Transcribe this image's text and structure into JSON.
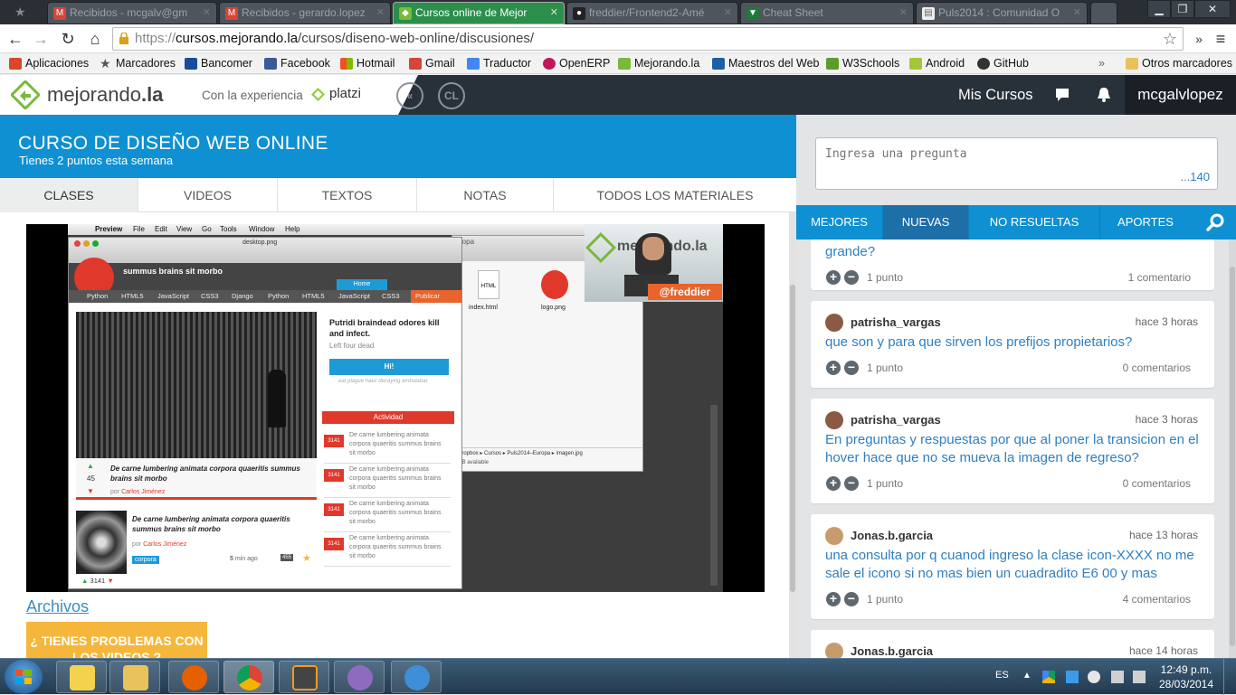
{
  "browser": {
    "tabs": [
      {
        "label": "Recibidos - mcgalv@gm",
        "color": "#d44638",
        "active": false
      },
      {
        "label": "Recibidos - gerardo.lopez",
        "color": "#d44638",
        "active": false
      },
      {
        "label": "Cursos online de Mejor",
        "color": "#7ab93b",
        "active": true
      },
      {
        "label": "freddier/Frontend2-Amé",
        "color": "#333333",
        "active": false
      },
      {
        "label": "Cheat Sheet",
        "color": "#1d7a3a",
        "active": false
      },
      {
        "label": "Puls2014 : Comunidad O",
        "color": "#ffffff",
        "active": false
      }
    ],
    "address": {
      "protocol": "https://",
      "host": "cursos.mejorando.la",
      "path": "/cursos/diseno-web-online/discusiones/"
    },
    "bookmarks": [
      {
        "label": "Aplicaciones",
        "color": "#d9472b"
      },
      {
        "label": "Marcadores",
        "color": "#555555"
      },
      {
        "label": "Bancomer",
        "color": "#1a4c9a"
      },
      {
        "label": "Facebook",
        "color": "#3b5998"
      },
      {
        "label": "Hotmail",
        "color": "#f25022"
      },
      {
        "label": "Gmail",
        "color": "#d44638"
      },
      {
        "label": "Traductor",
        "color": "#4285f4"
      },
      {
        "label": "OpenERP",
        "color": "#c2185b"
      },
      {
        "label": "Mejorando.la",
        "color": "#7ab93b"
      },
      {
        "label": "Maestros del Web",
        "color": "#1c5fa3"
      },
      {
        "label": "W3Schools",
        "color": "#5c9c2d"
      },
      {
        "label": "Android",
        "color": "#a4c639"
      },
      {
        "label": "GitHub",
        "color": "#333333"
      }
    ],
    "other_bookmarks": "Otros marcadores",
    "overflow_label": "»"
  },
  "site": {
    "logo_main": "mejorando",
    "logo_suffix": ".la",
    "experience_text": "Con la experiencia",
    "platzi": "platzi",
    "circle1": "«",
    "circle2": "CL",
    "mis_cursos": "Mis Cursos",
    "username": "mcgalvlopez"
  },
  "course": {
    "title": "CURSO DE DISEÑO WEB ONLINE",
    "points": "Tienes 2 puntos esta semana",
    "tabs": [
      "CLASES",
      "VIDEOS",
      "TEXTOS",
      "NOTAS",
      "TODOS LOS MATERIALES"
    ],
    "active_tab": "CLASES"
  },
  "video": {
    "app_menu": [
      "Preview",
      "File",
      "Edit",
      "View",
      "Go",
      "Tools",
      "Window",
      "Help"
    ],
    "window_title": "desktop.png",
    "blog_title": "summus brains sit morbo",
    "nav_items": [
      "Python",
      "HTML5",
      "JavaScript",
      "CSS3",
      "Django",
      "Python",
      "HTML5",
      "JavaScript",
      "CSS3"
    ],
    "nav_home": "Home",
    "nav_publish": "Publicar",
    "side_title": "Putridi braindead odores kill and infect.",
    "side_sub": "Left four dead",
    "side_button": "Hi!",
    "side_note": "eat plague haec decaying ambulabat.",
    "activity_label": "Actividad",
    "activity_badge": "3141",
    "activity_text": "De carne lumbering animata corpora quaeritis summus brains sit morbo",
    "post1_title": "De carne lumbering animata corpora quaeritis summus brains sit morbo",
    "post1_votes": "45",
    "post_author_prefix": "por",
    "post_author": "Carlos Jiménez",
    "post2_title": "De carne lumbering animata corpora quaeritis summus brains sit morbo",
    "post2_tag": "corpora",
    "post2_time_num": "5",
    "post2_time_unit": "min ago",
    "post2_comments": "455",
    "post2_votes": "3141",
    "finder_files": [
      "index.html",
      "logo.png"
    ],
    "finder_path": [
      "Dropbox",
      "Cursos",
      "Puls2014–Europa",
      "imagen.jpg"
    ],
    "finder_status": "GB available",
    "finder_title": "ropa",
    "presenter_handle": "@freddier",
    "presenter_logo": "mejorando.la"
  },
  "below_video": {
    "archivos": "Archivos",
    "problems": "¿ TIENES PROBLEMAS CON LOS VIDEOS ?"
  },
  "sidebar": {
    "ask_placeholder": "Ingresa una pregunta",
    "ask_counter": "...140",
    "filters": [
      "MEJORES",
      "NUEVAS",
      "NO RESUELTAS",
      "APORTES"
    ],
    "active_filter": "NUEVAS",
    "questions": [
      {
        "author": "",
        "time": "",
        "title": "grande?",
        "points": "1 punto",
        "comments": "1 comentario",
        "avatar": ""
      },
      {
        "author": "patrisha_vargas",
        "time": "hace 3 horas",
        "title": "que son y para que sirven los prefijos propietarios?",
        "points": "1 punto",
        "comments": "0 comentarios",
        "avatar": "#8a5a44"
      },
      {
        "author": "patrisha_vargas",
        "time": "hace 3 horas",
        "title": "En preguntas y respuestas por que al poner la transicion en el hover hace que no se mueva la imagen de regreso?",
        "points": "1 punto",
        "comments": "0 comentarios",
        "avatar": "#8a5a44"
      },
      {
        "author": "Jonas.b.garcia",
        "time": "hace 13 horas",
        "title": "una consulta por q cuanod ingreso la clase icon-XXXX no me sale el icono si no mas bien un cuadradito E6 00 y mas",
        "points": "1 punto",
        "comments": "4 comentarios",
        "avatar": "#c89b6d"
      },
      {
        "author": "Jonas.b.garcia",
        "time": "hace 14 horas",
        "title": "",
        "points": "",
        "comments": "",
        "avatar": "#c89b6d"
      }
    ]
  },
  "taskbar": {
    "lang": "ES",
    "time": "12:49 p.m.",
    "date": "28/03/2014",
    "apps": [
      {
        "name": "windows-explorer",
        "color": "#f3d24e"
      },
      {
        "name": "file-manager",
        "color": "#e8c25a"
      },
      {
        "name": "firefox",
        "color": "#e66000"
      },
      {
        "name": "chrome",
        "color": "#4caf50"
      },
      {
        "name": "sublime-text",
        "color": "#444444"
      },
      {
        "name": "pidgin",
        "color": "#8e6bbf"
      },
      {
        "name": "generic-app",
        "color": "#3e8fd8"
      }
    ]
  }
}
